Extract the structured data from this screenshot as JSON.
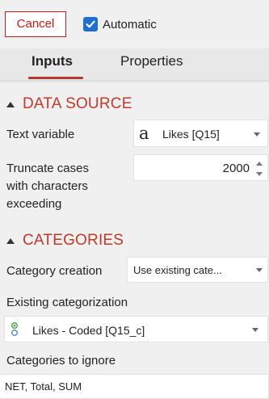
{
  "header": {
    "cancel_label": "Cancel",
    "automatic_label": "Automatic",
    "automatic_checked": true
  },
  "tabs": [
    {
      "label": "Inputs",
      "active": true
    },
    {
      "label": "Properties",
      "active": false
    }
  ],
  "data_source": {
    "title": "DATA SOURCE",
    "text_variable": {
      "label": "Text variable",
      "icon": "text-variable-icon",
      "value": "Likes [Q15]"
    },
    "truncate": {
      "label_lines": [
        "Truncate cases",
        "with characters",
        "exceeding"
      ],
      "value": "2000"
    }
  },
  "categories": {
    "title": "CATEGORIES",
    "category_creation": {
      "label": "Category creation",
      "value": "Use existing cate..."
    },
    "existing_categorization": {
      "label": "Existing categorization",
      "icon": "categorical-variable-icon",
      "value": "Likes - Coded [Q15_c]"
    },
    "categories_to_ignore": {
      "label": "Categories to ignore",
      "value": "NET, Total, SUM"
    }
  },
  "colors": {
    "accent_red": "#c0392b",
    "checkbox_blue": "#1e6fd0",
    "cancel_border": "#d01818",
    "icon_green": "#3a9a3a"
  }
}
